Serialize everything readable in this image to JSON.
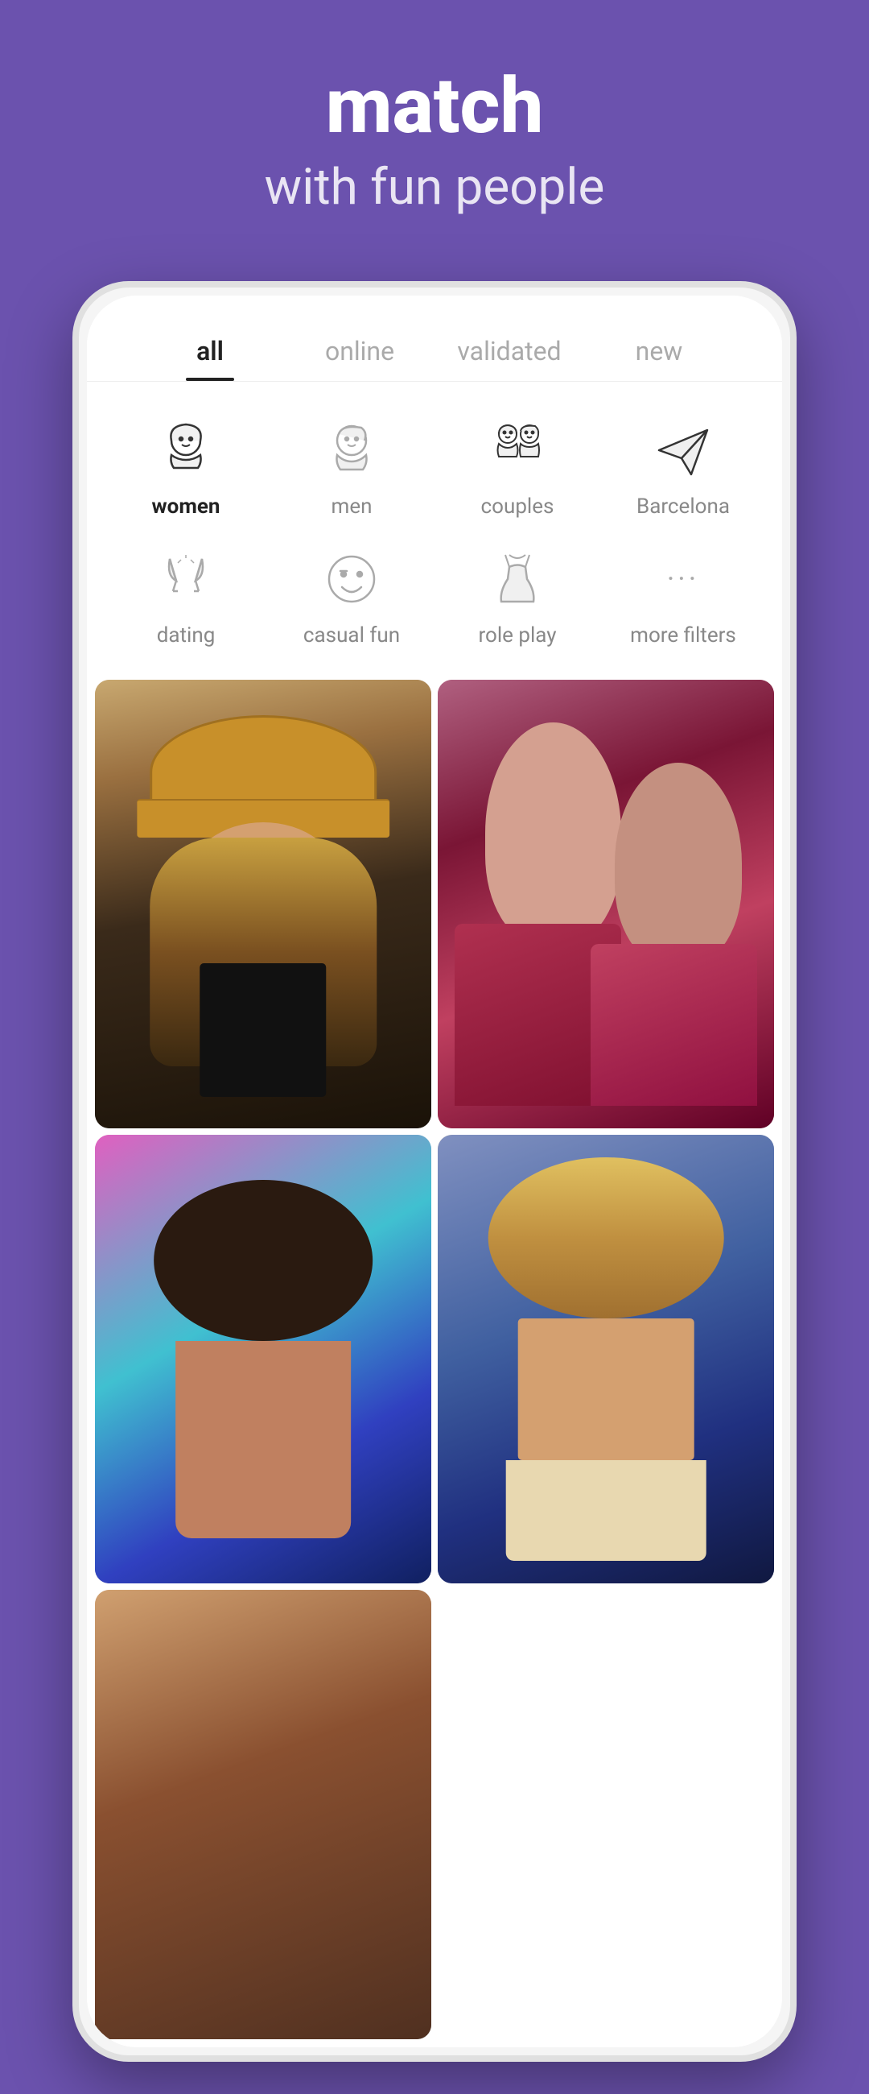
{
  "header": {
    "title": "match",
    "subtitle": "with fun people"
  },
  "tabs": [
    {
      "label": "all",
      "active": true
    },
    {
      "label": "online",
      "active": false
    },
    {
      "label": "validated",
      "active": false
    },
    {
      "label": "new",
      "active": false
    }
  ],
  "filters_row1": [
    {
      "id": "women",
      "label": "women",
      "active": true,
      "icon": "woman"
    },
    {
      "id": "men",
      "label": "men",
      "active": false,
      "icon": "man"
    },
    {
      "id": "couples",
      "label": "couples",
      "active": false,
      "icon": "couple"
    },
    {
      "id": "barcelona",
      "label": "Barcelona",
      "active": false,
      "icon": "location"
    }
  ],
  "filters_row2": [
    {
      "id": "dating",
      "label": "dating",
      "active": false,
      "icon": "champagne"
    },
    {
      "id": "casual",
      "label": "casual fun",
      "active": false,
      "icon": "smiley"
    },
    {
      "id": "roleplay",
      "label": "role play",
      "active": false,
      "icon": "dress"
    },
    {
      "id": "more",
      "label": "more filters",
      "active": false,
      "icon": "dots"
    }
  ],
  "photos": [
    {
      "id": "photo-1",
      "alt": "Woman with hat"
    },
    {
      "id": "photo-2",
      "alt": "Two women in red"
    },
    {
      "id": "photo-3",
      "alt": "Woman with graffiti"
    },
    {
      "id": "photo-4",
      "alt": "Blonde woman"
    },
    {
      "id": "photo-5",
      "alt": "Woman portrait"
    }
  ]
}
